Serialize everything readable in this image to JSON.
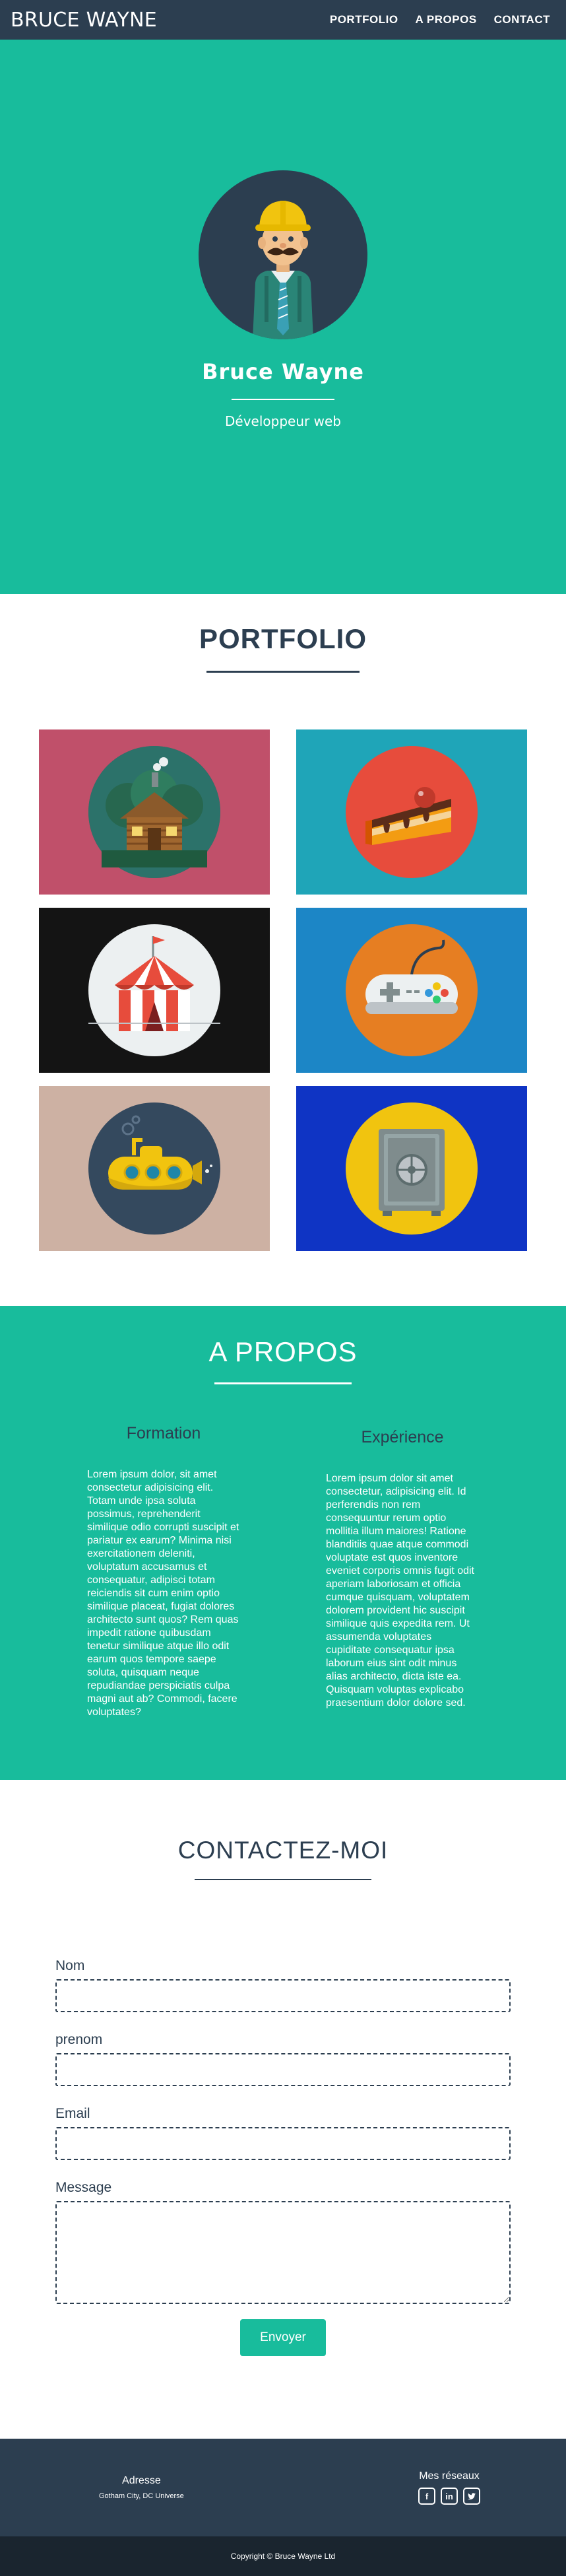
{
  "nav": {
    "brand": "BRUCE WAYNE",
    "links": [
      "PORTFOLIO",
      "A PROPOS",
      "CONTACT"
    ]
  },
  "hero": {
    "name": "Bruce Wayne",
    "role": "Développeur web"
  },
  "portfolio": {
    "title": "PORTFOLIO",
    "items": [
      {
        "icon": "cabin-icon",
        "bg": "#c0506a"
      },
      {
        "icon": "cake-icon",
        "bg": "#1fa5b8"
      },
      {
        "icon": "circus-tent-icon",
        "bg": "#141414"
      },
      {
        "icon": "game-controller-icon",
        "bg": "#1c86c6"
      },
      {
        "icon": "submarine-icon",
        "bg": "#cdb1a3"
      },
      {
        "icon": "safe-icon",
        "bg": "#0f34c4"
      }
    ]
  },
  "about": {
    "title": "A PROPOS",
    "formation": {
      "heading": "Formation",
      "text": "Lorem ipsum dolor, sit amet consectetur adipisicing elit. Totam unde ipsa soluta possimus, reprehenderit similique odio corrupti suscipit et pariatur ex earum? Minima nisi exercitationem deleniti, voluptatum accusamus et consequatur, adipisci totam reiciendis sit cum enim optio similique placeat, fugiat dolores architecto sunt quos? Rem quas impedit ratione quibusdam tenetur similique atque illo odit earum quos tempore saepe soluta, quisquam neque repudiandae perspiciatis culpa magni aut ab? Commodi, facere voluptates?"
    },
    "experience": {
      "heading": "Expérience",
      "text": "Lorem ipsum dolor sit amet consectetur, adipisicing elit. Id perferendis non rem consequuntur rerum optio mollitia illum maiores! Ratione blanditiis quae atque commodi voluptate est quos inventore eveniet corporis omnis fugit odit aperiam laboriosam et officia cumque quisquam, voluptatem dolorem provident hic suscipit similique quis expedita rem. Ut assumenda voluptates cupiditate consequatur ipsa laborum eius sint odit minus alias architecto, dicta iste ea. Quisquam voluptas explicabo praesentium dolor dolore sed."
    }
  },
  "contact": {
    "title": "CONTACTEZ-MOI",
    "fields": {
      "nom": "Nom",
      "prenom": "prenom",
      "email": "Email",
      "message": "Message"
    },
    "submit": "Envoyer"
  },
  "footer": {
    "address_title": "Adresse",
    "address": "Gotham City, DC Universe",
    "social_title": "Mes réseaux",
    "socials": [
      "facebook-icon",
      "linkedin-icon",
      "twitter-icon"
    ],
    "copyright": "Copyright © Bruce Wayne Ltd"
  },
  "colors": {
    "primary": "#2c3e50",
    "accent": "#18bc9c"
  }
}
